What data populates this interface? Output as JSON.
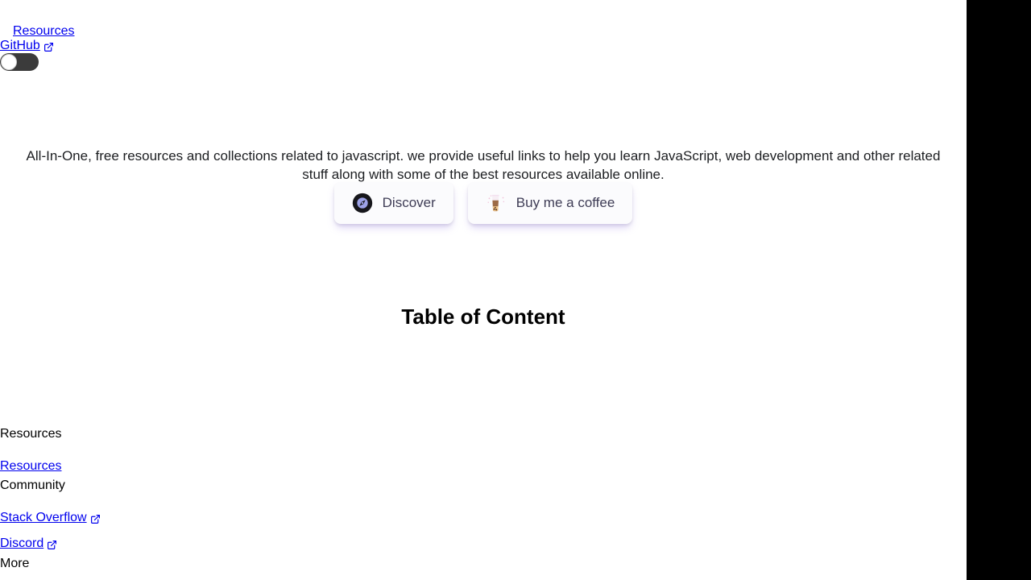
{
  "nav": {
    "resources_label": "Resources",
    "github_label": "GitHub",
    "external_icon": "external-link-icon",
    "theme_toggle": {
      "name": "dark-mode-toggle",
      "state": "off"
    }
  },
  "hero": {
    "description": "All-In-One, free resources and collections related to javascript. we provide useful links to help you learn JavaScript, web development and other related stuff along with some of the best resources available online.",
    "buttons": [
      {
        "label": "Discover",
        "icon": "compass-icon"
      },
      {
        "label": "Buy me a coffee",
        "icon": "bubble-tea-icon"
      }
    ]
  },
  "main": {
    "toc_heading": "Table of Content"
  },
  "footer": {
    "groups": [
      {
        "title": "Resources",
        "links": [
          {
            "label": "Resources",
            "external": false
          }
        ]
      },
      {
        "title": "Community",
        "links": [
          {
            "label": "Stack Overflow",
            "external": true
          },
          {
            "label": "Discord",
            "external": true
          }
        ]
      },
      {
        "title": "More",
        "links": []
      }
    ]
  },
  "colors": {
    "link": "#0000ee",
    "text": "#1c1e21",
    "button_bg": "#fbfbfd",
    "button_text": "#3e3c55",
    "button_shadow": "#aa96e6",
    "toggle_track": "#3b3b3b",
    "toggle_knob": "#ffffff",
    "right_panel": "#000000"
  }
}
